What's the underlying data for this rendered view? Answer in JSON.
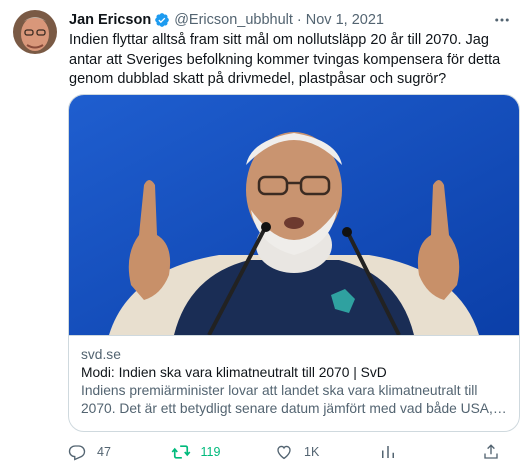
{
  "tweet": {
    "author": {
      "name": "Jan Ericson",
      "handle": "@Ericson_ubbhult",
      "separator": "·",
      "date": "Nov 1, 2021",
      "verified": true
    },
    "text": "Indien flyttar alltså fram sitt mål om nollutsläpp 20 år till 2070. Jag antar att Sveriges befolkning kommer tvingas kompensera för detta genom dubblad skatt på drivmedel, plastpåsar och sugrör?",
    "card": {
      "domain": "svd.se",
      "title": "Modi: Indien ska vara klimatneutralt till 2070 | SvD",
      "description": "Indiens premiärminister lovar att landet ska vara klimatneutralt till 2070. Det är ett betydligt senare datum jämfört med vad både USA, ..."
    },
    "actions": {
      "replies": "47",
      "retweets": "119",
      "likes": "1K"
    }
  },
  "icons": {
    "verified": "verified-badge-icon",
    "more": "more-icon",
    "reply": "reply-icon",
    "retweet": "retweet-icon",
    "like": "like-icon",
    "analytics": "analytics-icon",
    "share": "share-icon"
  },
  "colors": {
    "text": "#0f1419",
    "secondary": "#536471",
    "verified": "#1d9bf0",
    "retweeted": "#00ba7c",
    "border": "#cfd9de"
  }
}
